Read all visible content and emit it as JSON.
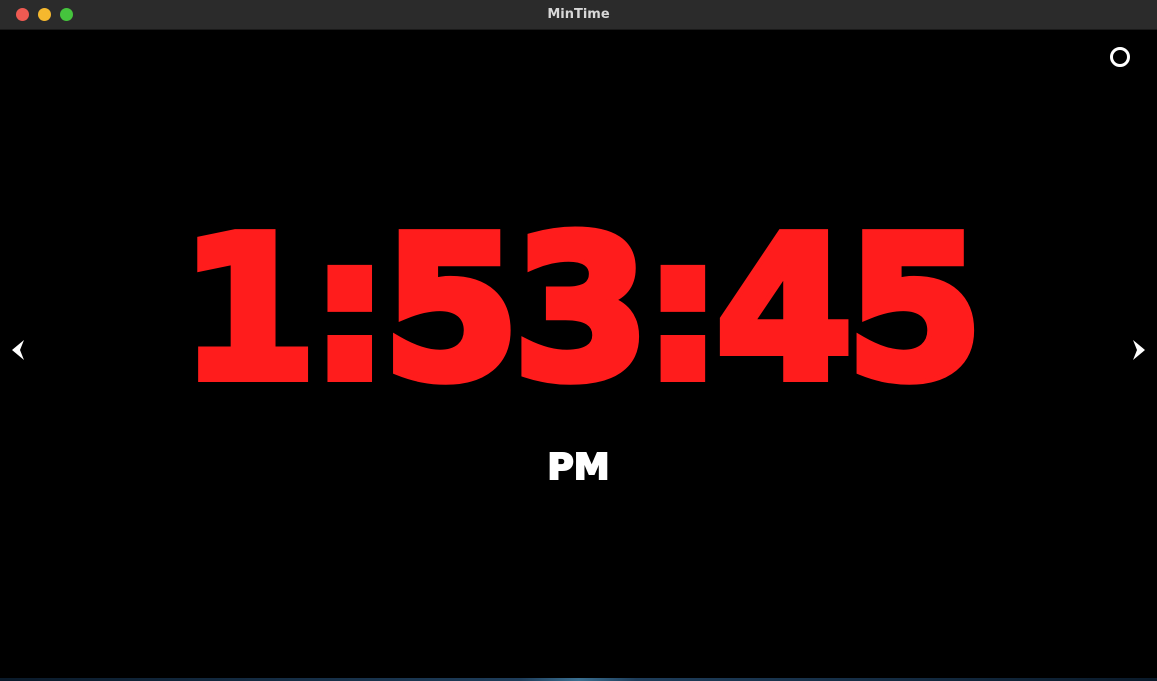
{
  "window": {
    "title": "MinTime"
  },
  "clock": {
    "time": "1:53:45",
    "period": "PM"
  },
  "colors": {
    "time_color": "#ff1c1c",
    "period_color": "#ffffff",
    "background": "#000000",
    "titlebar": "#2b2b2b",
    "traffic_close": "#ee5a52",
    "traffic_minimize": "#f5b82e",
    "traffic_maximize": "#45c43d"
  },
  "icons": {
    "settings": "circle-icon",
    "prev": "chevron-left-icon",
    "next": "chevron-right-icon"
  }
}
